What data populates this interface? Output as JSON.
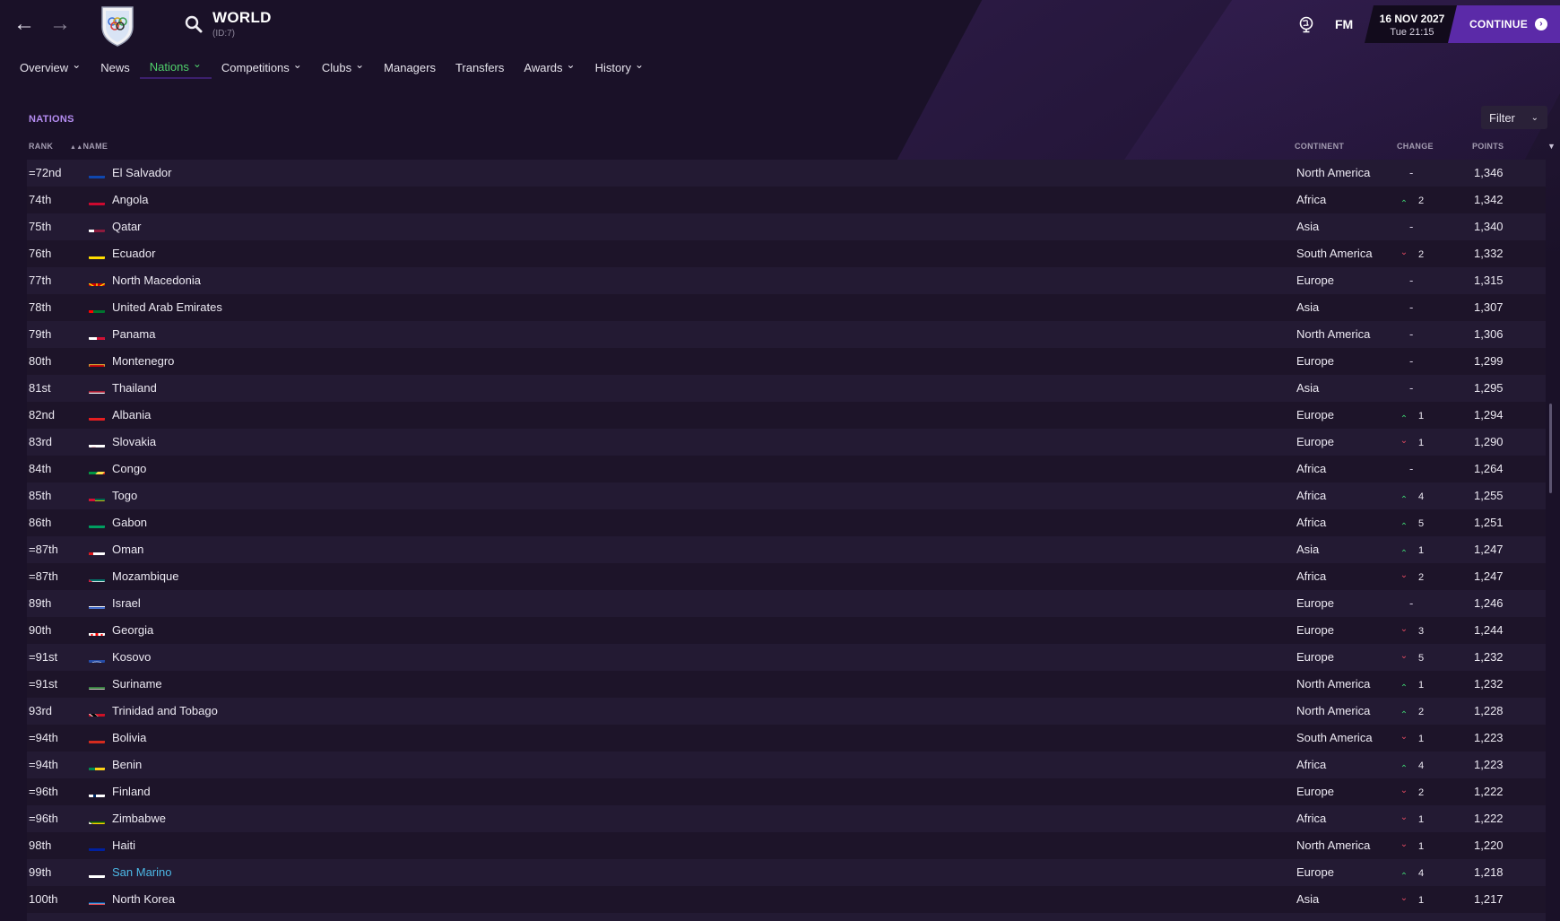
{
  "header": {
    "title": "WORLD",
    "subtitle": "(ID:7)",
    "date": "16 NOV 2027",
    "time": "Tue 21:15",
    "fm_label": "FM",
    "continue_label": "CONTINUE"
  },
  "menu": [
    {
      "label": "Overview",
      "dropdown": true,
      "active": false
    },
    {
      "label": "News",
      "dropdown": false,
      "active": false
    },
    {
      "label": "Nations",
      "dropdown": true,
      "active": true
    },
    {
      "label": "Competitions",
      "dropdown": true,
      "active": false
    },
    {
      "label": "Clubs",
      "dropdown": true,
      "active": false
    },
    {
      "label": "Managers",
      "dropdown": false,
      "active": false
    },
    {
      "label": "Transfers",
      "dropdown": false,
      "active": false
    },
    {
      "label": "Awards",
      "dropdown": true,
      "active": false
    },
    {
      "label": "History",
      "dropdown": true,
      "active": false
    }
  ],
  "section": {
    "title": "NATIONS",
    "filter_label": "Filter"
  },
  "columns": {
    "rank": "RANK",
    "name": "NAME",
    "continent": "CONTINENT",
    "change": "CHANGE",
    "points": "POINTS"
  },
  "colors": {
    "accent_purple": "#5b2aa8",
    "active_green": "#4fd06b",
    "up": "#3dcf70",
    "down": "#e04a60",
    "link": "#4cb8e6"
  },
  "rows": [
    {
      "rank": "=72nd",
      "name": "El Salvador",
      "continent": "North America",
      "dir": "none",
      "change": "-",
      "points": "1,346",
      "flag": "el-salvador"
    },
    {
      "rank": "74th",
      "name": "Angola",
      "continent": "Africa",
      "dir": "up",
      "change": "2",
      "points": "1,342",
      "flag": "angola"
    },
    {
      "rank": "75th",
      "name": "Qatar",
      "continent": "Asia",
      "dir": "none",
      "change": "-",
      "points": "1,340",
      "flag": "qatar"
    },
    {
      "rank": "76th",
      "name": "Ecuador",
      "continent": "South America",
      "dir": "down",
      "change": "2",
      "points": "1,332",
      "flag": "ecuador"
    },
    {
      "rank": "77th",
      "name": "North Macedonia",
      "continent": "Europe",
      "dir": "none",
      "change": "-",
      "points": "1,315",
      "flag": "north-macedonia"
    },
    {
      "rank": "78th",
      "name": "United Arab Emirates",
      "continent": "Asia",
      "dir": "none",
      "change": "-",
      "points": "1,307",
      "flag": "uae"
    },
    {
      "rank": "79th",
      "name": "Panama",
      "continent": "North America",
      "dir": "none",
      "change": "-",
      "points": "1,306",
      "flag": "panama"
    },
    {
      "rank": "80th",
      "name": "Montenegro",
      "continent": "Europe",
      "dir": "none",
      "change": "-",
      "points": "1,299",
      "flag": "montenegro"
    },
    {
      "rank": "81st",
      "name": "Thailand",
      "continent": "Asia",
      "dir": "none",
      "change": "-",
      "points": "1,295",
      "flag": "thailand"
    },
    {
      "rank": "82nd",
      "name": "Albania",
      "continent": "Europe",
      "dir": "up",
      "change": "1",
      "points": "1,294",
      "flag": "albania"
    },
    {
      "rank": "83rd",
      "name": "Slovakia",
      "continent": "Europe",
      "dir": "down",
      "change": "1",
      "points": "1,290",
      "flag": "slovakia"
    },
    {
      "rank": "84th",
      "name": "Congo",
      "continent": "Africa",
      "dir": "none",
      "change": "-",
      "points": "1,264",
      "flag": "congo"
    },
    {
      "rank": "85th",
      "name": "Togo",
      "continent": "Africa",
      "dir": "up",
      "change": "4",
      "points": "1,255",
      "flag": "togo"
    },
    {
      "rank": "86th",
      "name": "Gabon",
      "continent": "Africa",
      "dir": "up",
      "change": "5",
      "points": "1,251",
      "flag": "gabon"
    },
    {
      "rank": "=87th",
      "name": "Oman",
      "continent": "Asia",
      "dir": "up",
      "change": "1",
      "points": "1,247",
      "flag": "oman"
    },
    {
      "rank": "=87th",
      "name": "Mozambique",
      "continent": "Africa",
      "dir": "down",
      "change": "2",
      "points": "1,247",
      "flag": "mozambique"
    },
    {
      "rank": "89th",
      "name": "Israel",
      "continent": "Europe",
      "dir": "none",
      "change": "-",
      "points": "1,246",
      "flag": "israel"
    },
    {
      "rank": "90th",
      "name": "Georgia",
      "continent": "Europe",
      "dir": "down",
      "change": "3",
      "points": "1,244",
      "flag": "georgia"
    },
    {
      "rank": "=91st",
      "name": "Kosovo",
      "continent": "Europe",
      "dir": "down",
      "change": "5",
      "points": "1,232",
      "flag": "kosovo"
    },
    {
      "rank": "=91st",
      "name": "Suriname",
      "continent": "North America",
      "dir": "up",
      "change": "1",
      "points": "1,232",
      "flag": "suriname"
    },
    {
      "rank": "93rd",
      "name": "Trinidad and Tobago",
      "continent": "North America",
      "dir": "up",
      "change": "2",
      "points": "1,228",
      "flag": "trinidad"
    },
    {
      "rank": "=94th",
      "name": "Bolivia",
      "continent": "South America",
      "dir": "down",
      "change": "1",
      "points": "1,223",
      "flag": "bolivia"
    },
    {
      "rank": "=94th",
      "name": "Benin",
      "continent": "Africa",
      "dir": "up",
      "change": "4",
      "points": "1,223",
      "flag": "benin"
    },
    {
      "rank": "=96th",
      "name": "Finland",
      "continent": "Europe",
      "dir": "down",
      "change": "2",
      "points": "1,222",
      "flag": "finland"
    },
    {
      "rank": "=96th",
      "name": "Zimbabwe",
      "continent": "Africa",
      "dir": "down",
      "change": "1",
      "points": "1,222",
      "flag": "zimbabwe"
    },
    {
      "rank": "98th",
      "name": "Haiti",
      "continent": "North America",
      "dir": "down",
      "change": "1",
      "points": "1,220",
      "flag": "haiti"
    },
    {
      "rank": "99th",
      "name": "San Marino",
      "continent": "Europe",
      "dir": "up",
      "change": "4",
      "points": "1,218",
      "flag": "san-marino",
      "highlight": true
    },
    {
      "rank": "100th",
      "name": "North Korea",
      "continent": "Asia",
      "dir": "down",
      "change": "1",
      "points": "1,217",
      "flag": "north-korea"
    }
  ]
}
